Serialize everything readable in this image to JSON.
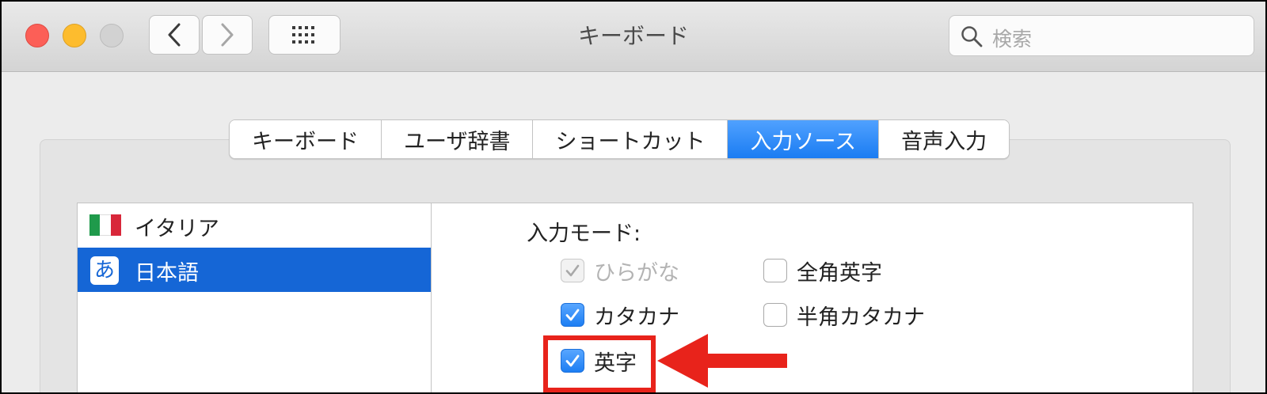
{
  "window": {
    "title": "キーボード"
  },
  "search": {
    "placeholder": "検索"
  },
  "tabs": [
    {
      "label": "キーボード",
      "selected": false
    },
    {
      "label": "ユーザ辞書",
      "selected": false
    },
    {
      "label": "ショートカット",
      "selected": false
    },
    {
      "label": "入力ソース",
      "selected": true
    },
    {
      "label": "音声入力",
      "selected": false
    }
  ],
  "sources": [
    {
      "label": "イタリア",
      "icon": "italy-flag-icon",
      "selected": false
    },
    {
      "label": "日本語",
      "icon_text": "あ",
      "icon": "hiragana-icon",
      "selected": true
    }
  ],
  "input_mode": {
    "label": "入力モード:",
    "options": [
      {
        "label": "ひらがな",
        "checked": true,
        "disabled": true
      },
      {
        "label": "全角英字",
        "checked": false,
        "disabled": false
      },
      {
        "label": "カタカナ",
        "checked": true,
        "disabled": false
      },
      {
        "label": "半角カタカナ",
        "checked": false,
        "disabled": false
      },
      {
        "label": "英字",
        "checked": true,
        "disabled": false
      }
    ]
  },
  "colors": {
    "accent": "#1a7cf2",
    "selection": "#1566d6",
    "annotation": "#e8231b",
    "close": "#fc5f57",
    "minimize": "#fdbc2e"
  }
}
